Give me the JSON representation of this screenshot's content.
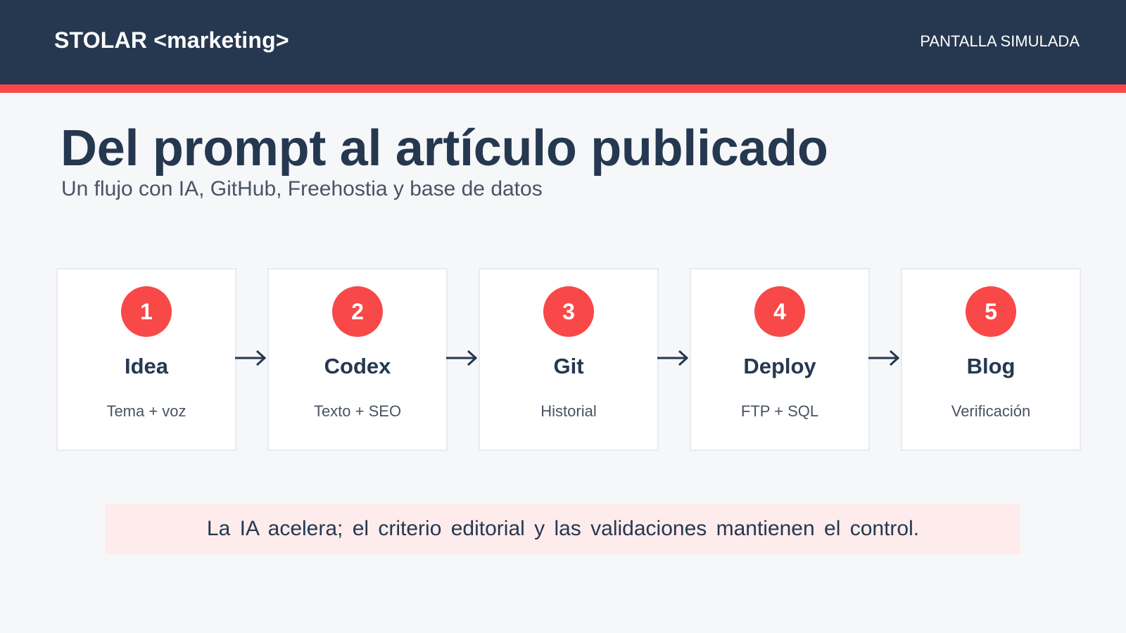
{
  "header": {
    "brand": "STOLAR <marketing>",
    "tag": "PANTALLA SIMULADA"
  },
  "main": {
    "title": "Del prompt al artículo publicado",
    "subtitle": "Un flujo con IA, GitHub, Freehostia y base de datos"
  },
  "steps": [
    {
      "number": "1",
      "title": "Idea",
      "subtitle": "Tema + voz"
    },
    {
      "number": "2",
      "title": "Codex",
      "subtitle": "Texto + SEO"
    },
    {
      "number": "3",
      "title": "Git",
      "subtitle": "Historial"
    },
    {
      "number": "4",
      "title": "Deploy",
      "subtitle": "FTP + SQL"
    },
    {
      "number": "5",
      "title": "Blog",
      "subtitle": "Verificación"
    }
  ],
  "callout": {
    "text": "La IA acelera; el criterio editorial y las validaciones mantienen el control."
  },
  "colors": {
    "header_bg": "#263850",
    "accent": "#f84848",
    "page_bg": "#f6f7f9",
    "callout_bg": "#feecec",
    "text_dark": "#253850"
  }
}
